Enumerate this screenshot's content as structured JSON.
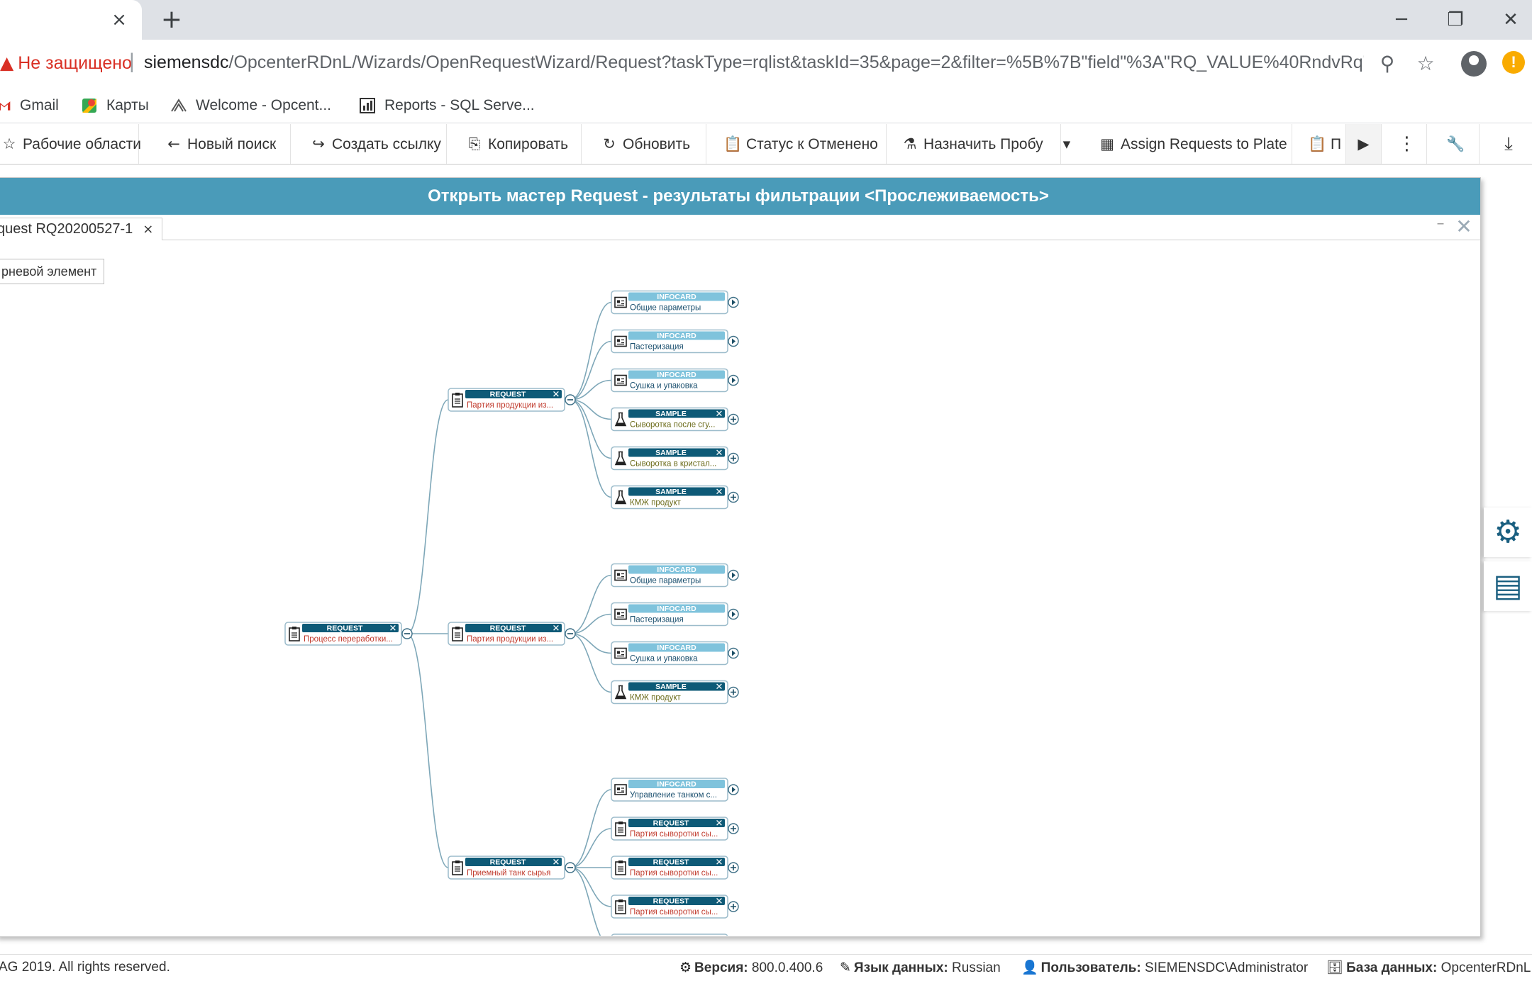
{
  "browser": {
    "tab": {
      "close_icon": "×"
    },
    "new_tab_icon": "+",
    "window_controls": {
      "minimize": "─",
      "restore": "❐",
      "close": "✕"
    }
  },
  "address": {
    "security_label": "Не защищено",
    "host": "siemensdc",
    "path": "/OpcenterRDnL/Wizards/OpenRequestWizard/Request?taskType=rqlist&taskId=35&page=2&filter=%5B%7B\"field\"%3A\"RQ_VALUE%40RndvRq\"%2C\"..."
  },
  "bookmarks": [
    {
      "label": "Gmail",
      "icon": "gmail-icon"
    },
    {
      "label": "Карты",
      "icon": "maps-icon"
    },
    {
      "label": "Welcome - Opcent...",
      "icon": "opcenter-icon"
    },
    {
      "label": "Reports - SQL Serve...",
      "icon": "reports-icon"
    }
  ],
  "toolbar": {
    "items": [
      {
        "label": "Рабочие области",
        "icon": "☆"
      },
      {
        "label": "Новый поиск",
        "icon": "←"
      },
      {
        "label": "Создать ссылку",
        "icon": "↪"
      },
      {
        "label": "Копировать",
        "icon": "⎘"
      },
      {
        "label": "Обновить",
        "icon": "↻"
      },
      {
        "label": "Статус к Отменено",
        "icon": "📋"
      },
      {
        "label": "Назначить Пробу",
        "icon": "⚗"
      },
      {
        "label": "Assign Requests to Plate",
        "icon": "▦"
      },
      {
        "label": "П",
        "icon": "📋"
      }
    ],
    "dropdown_icon": "▾",
    "scroll_right_icon": "▶",
    "more_icon": "⋮",
    "wrench_icon": "🔧",
    "download_icon": "⤓"
  },
  "panel": {
    "title": "Открыть мастер Request - результаты фильтрации <Прослеживаемость>",
    "doc_tab": "quest RQ20200527-1",
    "doc_tab_close": "×",
    "minimize": "–",
    "close": "✕",
    "root_button": "рневой элемент"
  },
  "tree": {
    "root": {
      "type": "REQUEST",
      "label": "Процесс переработки..."
    },
    "groups": [
      {
        "node": {
          "type": "REQUEST",
          "label": "Партия продукции из..."
        },
        "children": [
          {
            "type": "INFOCARD",
            "label": "Общие параметры",
            "action": "arrow"
          },
          {
            "type": "INFOCARD",
            "label": "Пастеризация",
            "action": "arrow"
          },
          {
            "type": "INFOCARD",
            "label": "Сушка и упаковка",
            "action": "arrow"
          },
          {
            "type": "SAMPLE",
            "label": "Сыворотка после сгу...",
            "action": "plus"
          },
          {
            "type": "SAMPLE",
            "label": "Сыворотка в кристал...",
            "action": "plus"
          },
          {
            "type": "SAMPLE",
            "label": "КМЖ продукт",
            "action": "plus"
          }
        ]
      },
      {
        "node": {
          "type": "REQUEST",
          "label": "Партия продукции из..."
        },
        "children": [
          {
            "type": "INFOCARD",
            "label": "Общие параметры",
            "action": "arrow"
          },
          {
            "type": "INFOCARD",
            "label": "Пастеризация",
            "action": "arrow"
          },
          {
            "type": "INFOCARD",
            "label": "Сушка и упаковка",
            "action": "arrow"
          },
          {
            "type": "SAMPLE",
            "label": "КМЖ продукт",
            "action": "plus"
          }
        ]
      },
      {
        "node": {
          "type": "REQUEST",
          "label": "Приемный танк сырья"
        },
        "children": [
          {
            "type": "INFOCARD",
            "label": "Управление танком с...",
            "action": "arrow"
          },
          {
            "type": "REQUEST",
            "label": "Партия сыворотки сы...",
            "action": "plus"
          },
          {
            "type": "REQUEST",
            "label": "Партия сыворотки сы...",
            "action": "plus"
          },
          {
            "type": "REQUEST",
            "label": "Партия сыворотки сы...",
            "action": "plus"
          },
          {
            "type": "SAMPLE",
            "label": "",
            "action": "plus"
          }
        ]
      }
    ]
  },
  "side_tools": [
    {
      "name": "settings",
      "icon": "⚙"
    },
    {
      "name": "report",
      "icon": "▤"
    }
  ],
  "footer": {
    "copyright": "AG 2019. All rights reserved.",
    "version_label": "Версия:",
    "version_value": "800.0.400.6",
    "language_label": "Язык данных:",
    "language_value": "Russian",
    "user_label": "Пользователь:",
    "user_value": "SIEMENSDC\\Administrator",
    "db_label": "База данных:",
    "db_value": "OpcenterRDnL"
  },
  "colors": {
    "header_bg": "#4a9bb9",
    "node_dark": "#0e5a77",
    "node_light": "#7fc3dc",
    "request_text": "#c0392b",
    "sample_text": "#6b6b1a",
    "infocard_text": "#1a4f6e",
    "link_line": "#7ea7b8"
  }
}
